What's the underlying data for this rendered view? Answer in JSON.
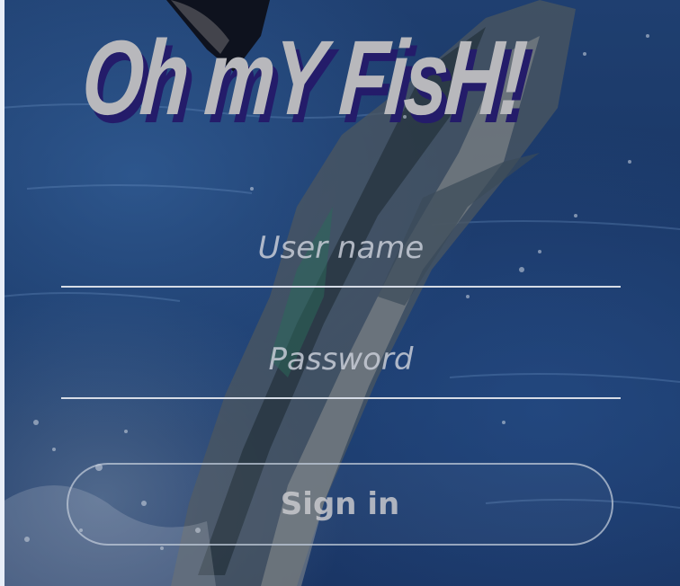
{
  "app": {
    "logo_text": "Oh mY FisH!"
  },
  "login_form": {
    "username": {
      "placeholder": "User name",
      "value": ""
    },
    "password": {
      "placeholder": "Password",
      "value": ""
    },
    "submit_label": "Sign in"
  },
  "colors": {
    "logo_fill": "#b8b8bc",
    "logo_shadow": "#241c6a",
    "background": "#1c3a68",
    "field_underline": "#d6dce6"
  }
}
